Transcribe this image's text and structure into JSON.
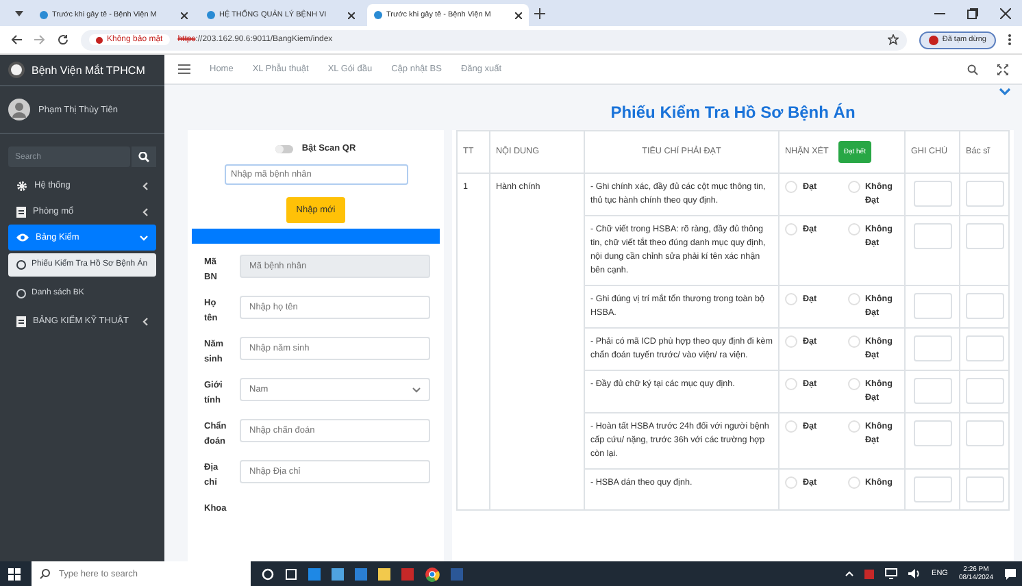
{
  "browser": {
    "tabs": [
      {
        "title": "Trước khi gây tê - Bệnh Viện M",
        "selected": false
      },
      {
        "title": "HỆ THỐNG QUẢN LÝ BỆNH VI",
        "selected": false
      },
      {
        "title": "Trước khi gây tê - Bệnh Viện M",
        "selected": true
      }
    ],
    "security": "Không bảo mật",
    "url_scheme": "https",
    "url_rest": "://203.162.90.6:9011/BangKiem/index",
    "profile": "Đã tạm dừng"
  },
  "sidebar": {
    "brand": "Bệnh Viện Mắt TPHCM",
    "user": "Phạm Thị Thùy Tiên",
    "search_placeholder": "Search",
    "items": [
      {
        "label": "Hệ thống",
        "selected": false,
        "expanded": false
      },
      {
        "label": "Phòng mổ",
        "selected": false,
        "expanded": false
      },
      {
        "label": "Bảng Kiểm",
        "selected": true,
        "expanded": true,
        "children": [
          {
            "label": "Phiếu Kiểm Tra Hồ Sơ Bệnh Án",
            "selected": true
          },
          {
            "label": "Danh sách BK",
            "selected": false
          }
        ]
      },
      {
        "label": "BẢNG KIỂM KỸ THUẬT",
        "selected": false,
        "expanded": false
      }
    ]
  },
  "navbar": {
    "links": [
      "Home",
      "XL Phẫu thuật",
      "XL Gói đầu",
      "Cập nhật BS",
      "Đăng xuất"
    ]
  },
  "page_title": "Phiếu Kiểm Tra Hồ Sơ Bệnh Án",
  "form": {
    "scan_qr": {
      "label": "Bật Scan QR",
      "on": false
    },
    "patient_code_placeholder": "Nhập mã bệnh nhân",
    "new_button": "Nhập mới",
    "fields": [
      {
        "kind": "text",
        "label": "Mã BN",
        "placeholder": "Mã bệnh nhân",
        "disabled": true
      },
      {
        "kind": "text",
        "label": "Họ tên",
        "placeholder": "Nhập họ tên",
        "disabled": false
      },
      {
        "kind": "text",
        "label": "Năm sinh",
        "placeholder": "Nhập năm sinh",
        "disabled": false
      },
      {
        "kind": "select",
        "label": "Giới tính",
        "value": "Nam",
        "disabled": false
      },
      {
        "kind": "text",
        "label": "Chẩn đoán",
        "placeholder": "Nhập chẩn đoán",
        "disabled": false
      },
      {
        "kind": "text",
        "label": "Địa chỉ",
        "placeholder": "Nhập Địa chỉ",
        "disabled": false
      },
      {
        "kind": "label",
        "label": "Khoa"
      }
    ]
  },
  "table": {
    "columns": [
      "TT",
      "NỘI DUNG",
      "TIÊU CHÍ PHẢI ĐẠT",
      "NHẬN XÉT",
      "GHI CHÚ",
      "Bác sĩ"
    ],
    "mark_all_button": "Đạt hết",
    "groups": [
      {
        "tt": "1",
        "content": "Hành chính",
        "criteria": [
          {
            "text": "- Ghi chính xác, đầy đủ các cột mục thông tin, thủ tục hành chính theo quy định.",
            "options": [
              {
                "label": "Đạt",
                "selected": false
              },
              {
                "label": "Không Đạt",
                "selected": false
              }
            ]
          },
          {
            "text": "- Chữ viết trong HSBA: rõ ràng, đầy đủ thông tin, chữ viết tắt theo đúng danh mục quy định, nội dung cần chỉnh sửa phải kí tên xác nhận bên cạnh.",
            "options": [
              {
                "label": "Đạt",
                "selected": false
              },
              {
                "label": "Không Đạt",
                "selected": false
              }
            ]
          },
          {
            "text": "- Ghi đúng vị trí mắt tổn thương trong toàn bộ HSBA.",
            "options": [
              {
                "label": "Đạt",
                "selected": false
              },
              {
                "label": "Không Đạt",
                "selected": false
              }
            ]
          },
          {
            "text": "- Phải có mã ICD phù hợp theo quy định đi kèm chẩn đoán tuyến trước/ vào viện/ ra viện.",
            "options": [
              {
                "label": "Đạt",
                "selected": false
              },
              {
                "label": "Không Đạt",
                "selected": false
              }
            ]
          },
          {
            "text": "- Đầy đủ chữ ký tại các mục quy định.",
            "options": [
              {
                "label": "Đạt",
                "selected": false
              },
              {
                "label": "Không Đạt",
                "selected": false
              }
            ]
          },
          {
            "text": "- Hoàn tất HSBA trước 24h đối với người bệnh cấp cứu/ nặng, trước 36h với các trường hợp còn lại.",
            "options": [
              {
                "label": "Đạt",
                "selected": false
              },
              {
                "label": "Không Đạt",
                "selected": false
              }
            ]
          },
          {
            "text": "- HSBA dán theo quy định.",
            "options": [
              {
                "label": "Đạt",
                "selected": false
              },
              {
                "label": "Không",
                "selected": false
              }
            ]
          }
        ]
      }
    ]
  },
  "taskbar": {
    "search_placeholder": "Type here to search",
    "language": "ENG",
    "time": "2:26 PM",
    "date": "08/14/2024"
  }
}
